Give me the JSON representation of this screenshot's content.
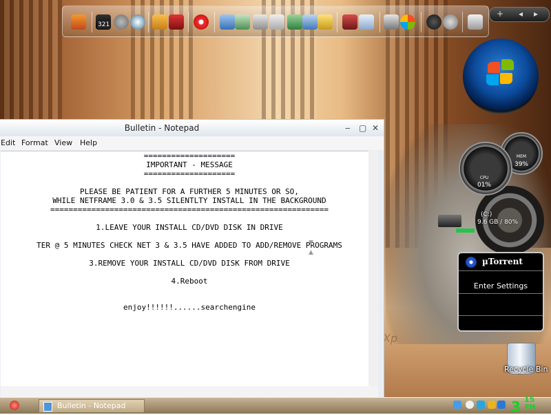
{
  "notepad": {
    "title": "Bulletin - Notepad",
    "menu": [
      "Edit",
      "Format",
      "View",
      "Help"
    ],
    "lines": [
      "====================",
      "IMPORTANT - MESSAGE",
      "====================",
      "PLEASE BE PATIENT FOR A FURTHER 5 MINUTES OR SO,",
      "WHILE NETFRAME 3.0 & 3.5 SILENTLTY INSTALL IN THE BACKGROUND",
      "=============================================================",
      "1.LEAVE YOUR INSTALL CD/DVD DISK IN DRIVE",
      "TER @ 5 MINUTES CHECK NET 3 & 3.5 HAVE ADDED TO ADD/REMOVE PROGRAMS",
      "3.REMOVE YOUR INSTALL CD/DVD DISK FROM DRIVE",
      "4.Reboot",
      "enjoy!!!!!!......searchengine"
    ]
  },
  "dock": {
    "counter": "321"
  },
  "gadgets": {
    "cpu": {
      "label": "CPU",
      "value": "01%"
    },
    "mem": {
      "label": "MEM",
      "value": "39%"
    },
    "drive": {
      "label": "(C:)",
      "info": "9.6 GB / 80%",
      "used_fraction": 0.8
    }
  },
  "utorrent": {
    "title": "µTorrent",
    "settings_label": "Enter Settings"
  },
  "desktop": {
    "recycle_bin_label": "Recycle Bin",
    "watermark": "Xp"
  },
  "taskbar": {
    "task_label": "Bulletin - Notepad",
    "clock": {
      "hour": "3",
      "minutes": "15",
      "ampm": "PM"
    }
  },
  "colors": {
    "clock": "#17d02a",
    "orb": "#0c4a9b",
    "drive_bar": "#27c24c"
  }
}
